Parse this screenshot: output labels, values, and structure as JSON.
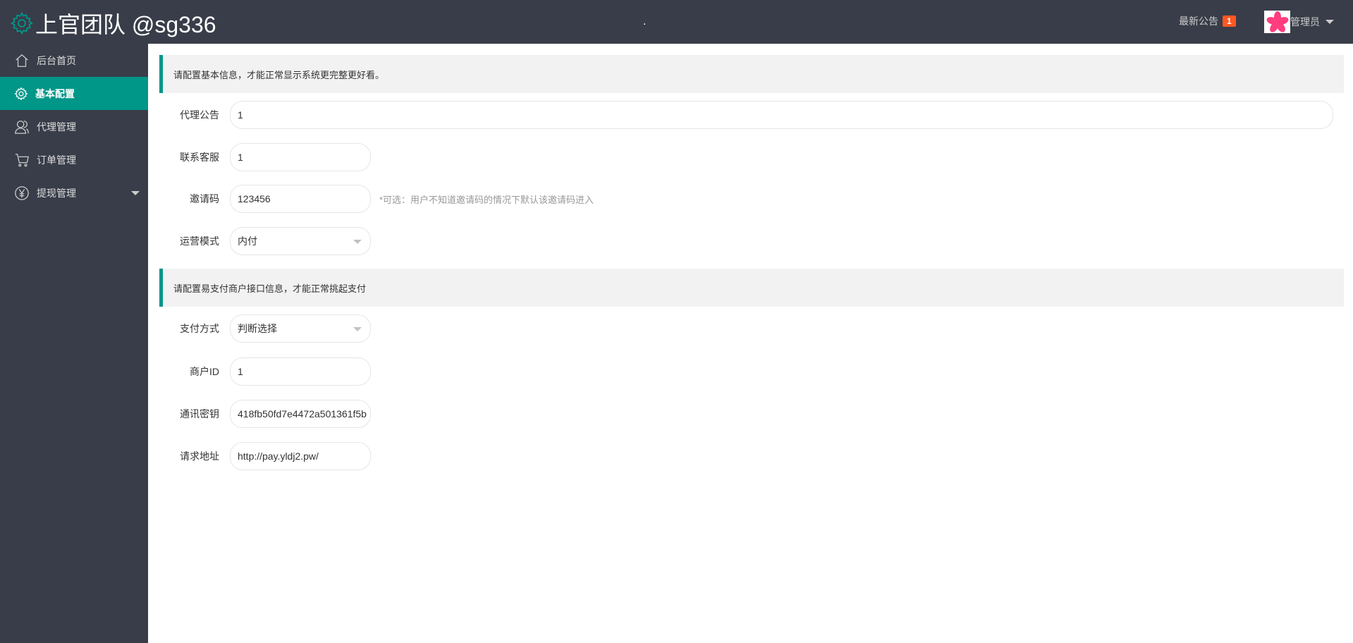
{
  "header": {
    "title": "上官团队 @sg336",
    "dot": ".",
    "notice_label": "最新公告",
    "notice_count": "1",
    "user_name": "管理员"
  },
  "sidebar": {
    "items": [
      {
        "label": "后台首页",
        "icon": "home-icon"
      },
      {
        "label": "基本配置",
        "icon": "gear-icon",
        "active": true
      },
      {
        "label": "代理管理",
        "icon": "user-icon"
      },
      {
        "label": "订单管理",
        "icon": "cart-icon"
      },
      {
        "label": "提现管理",
        "icon": "yen-icon",
        "expandable": true
      }
    ]
  },
  "section1": {
    "notice": "请配置基本信息，才能正常显示系统更完整更好看。",
    "fields": [
      {
        "label": "代理公告",
        "value": "1"
      },
      {
        "label": "联系客服",
        "value": "1"
      },
      {
        "label": "邀请码",
        "value": "123456",
        "hint": "*可选：用户不知道邀请码的情况下默认该邀请码进入"
      },
      {
        "label": "运营模式",
        "value": "内付"
      }
    ]
  },
  "section2": {
    "notice": "请配置易支付商户接口信息，才能正常挑起支付",
    "fields": [
      {
        "label": "支付方式",
        "value": "判断选择"
      },
      {
        "label": "商户ID",
        "value": "1"
      },
      {
        "label": "通讯密钥",
        "value": "418fb50fd7e4472a501361f5b"
      },
      {
        "label": "请求地址",
        "value": "http://pay.yldj2.pw/"
      }
    ]
  },
  "colors": {
    "accent": "#009688",
    "header_bg": "#393d49",
    "badge": "#ff5722"
  }
}
